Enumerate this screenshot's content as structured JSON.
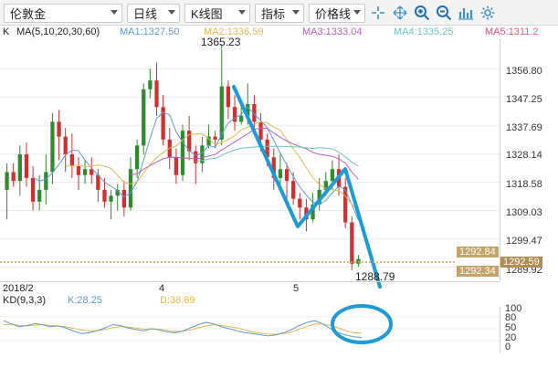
{
  "toolbar": {
    "symbol": "伦敦金",
    "period": "日线",
    "chart_type": "K线图",
    "indicator": "指标",
    "price_line": "价格线",
    "icons": [
      "crosshair-icon",
      "arrows-icon",
      "zoom-in-icon",
      "zoom-out-icon",
      "bar-chart-icon",
      "settings-icon"
    ]
  },
  "ma": {
    "k": "K",
    "params": "MA(5,10,20,30,60)",
    "ma1": "MA1:1327.50",
    "ma2": "MA2:1336.59",
    "ma3": "MA3:1333.04",
    "ma4": "MA4:1335.25",
    "ma5": "MA5:1311.2",
    "colors": {
      "ma1": "#5b9bd5",
      "ma2": "#e8b64a",
      "ma3": "#b85fc4",
      "ma4": "#6cc4c4",
      "ma5": "#e05a7a"
    }
  },
  "annotations": {
    "high": "1365.23",
    "low": "1288.79"
  },
  "price_axis": {
    "ticks": [
      "1356.80",
      "1347.25",
      "1337.69",
      "1328.14",
      "1318.58",
      "1309.03",
      "1299.47",
      "1289.92"
    ],
    "tag_upper": "1292.84",
    "tag_current": "1292.59",
    "tag_lower": "1292.34"
  },
  "date_axis": {
    "labels": [
      "2018/2",
      "4",
      "5"
    ]
  },
  "kd": {
    "params": "KD(9,3,3)",
    "k": "K:28.25",
    "d": "D:38.89",
    "ticks": [
      "100",
      "80",
      "50",
      "20",
      "0"
    ],
    "colors": {
      "k": "#5b9bd5",
      "d": "#e8b64a"
    }
  },
  "colors": {
    "up": "#2e8b2e",
    "down": "#d03030",
    "annotation": "#1e9bd7",
    "tag": "#c5a368"
  },
  "chart_data": {
    "type": "candlestick",
    "y_range": [
      1286,
      1366
    ],
    "candles": [
      [
        1316,
        1322,
        1306,
        1325
      ],
      [
        1322,
        1319,
        1317,
        1325
      ],
      [
        1319,
        1328,
        1314,
        1331
      ],
      [
        1328,
        1320,
        1317,
        1332
      ],
      [
        1320,
        1312,
        1309,
        1324
      ],
      [
        1312,
        1316,
        1309,
        1321
      ],
      [
        1316,
        1322,
        1311,
        1328
      ],
      [
        1322,
        1339,
        1318,
        1342
      ],
      [
        1339,
        1334,
        1326,
        1343
      ],
      [
        1334,
        1328,
        1322,
        1337
      ],
      [
        1328,
        1324,
        1320,
        1335
      ],
      [
        1324,
        1321,
        1316,
        1327
      ],
      [
        1321,
        1323,
        1318,
        1326
      ],
      [
        1323,
        1321,
        1318,
        1327
      ],
      [
        1321,
        1316,
        1312,
        1323
      ],
      [
        1316,
        1312,
        1310,
        1320
      ],
      [
        1312,
        1314,
        1306,
        1316
      ],
      [
        1314,
        1316,
        1309,
        1318
      ],
      [
        1316,
        1310,
        1307,
        1319
      ],
      [
        1310,
        1323,
        1309,
        1327
      ],
      [
        1323,
        1331,
        1320,
        1333
      ],
      [
        1331,
        1350,
        1328,
        1352
      ],
      [
        1350,
        1353,
        1347,
        1357
      ],
      [
        1353,
        1344,
        1341,
        1359
      ],
      [
        1344,
        1333,
        1331,
        1348
      ],
      [
        1333,
        1327,
        1323,
        1337
      ],
      [
        1327,
        1321,
        1318,
        1330
      ],
      [
        1321,
        1336,
        1319,
        1338
      ],
      [
        1336,
        1329,
        1326,
        1341
      ],
      [
        1329,
        1325,
        1318,
        1331
      ],
      [
        1325,
        1331,
        1322,
        1334
      ],
      [
        1331,
        1334,
        1330,
        1338
      ],
      [
        1334,
        1333,
        1330,
        1336
      ],
      [
        1333,
        1351,
        1331,
        1365.23
      ],
      [
        1351,
        1344,
        1340,
        1353
      ],
      [
        1344,
        1339,
        1336,
        1348
      ],
      [
        1339,
        1341,
        1338,
        1346
      ],
      [
        1341,
        1345,
        1338,
        1352
      ],
      [
        1345,
        1339,
        1335,
        1348
      ],
      [
        1339,
        1333,
        1329,
        1342
      ],
      [
        1333,
        1327,
        1324,
        1335
      ],
      [
        1327,
        1320,
        1316,
        1330
      ],
      [
        1320,
        1323,
        1316,
        1328
      ],
      [
        1323,
        1319,
        1313,
        1325
      ],
      [
        1319,
        1313,
        1311,
        1322
      ],
      [
        1313,
        1310,
        1306,
        1315
      ],
      [
        1310,
        1306,
        1302,
        1313
      ],
      [
        1306,
        1311,
        1305,
        1315
      ],
      [
        1311,
        1316,
        1309,
        1320
      ],
      [
        1316,
        1319,
        1314,
        1322
      ],
      [
        1319,
        1323,
        1316,
        1326
      ],
      [
        1323,
        1317,
        1314,
        1328
      ],
      [
        1317,
        1305,
        1303,
        1320
      ],
      [
        1305,
        1291,
        1288.79,
        1307
      ],
      [
        1291,
        1292.59,
        1290,
        1294
      ]
    ],
    "kd_k": [
      70,
      62,
      55,
      58,
      63,
      60,
      55,
      57,
      52,
      44,
      38,
      40,
      45,
      52,
      60,
      58,
      52,
      48,
      45,
      50,
      47,
      42,
      40,
      44,
      52,
      60,
      66,
      62,
      55,
      50,
      45,
      40,
      38,
      35,
      32,
      35,
      40,
      48,
      58,
      66,
      70,
      62,
      50,
      40,
      34,
      30,
      28.25
    ],
    "kd_d": [
      60,
      61,
      58,
      57,
      59,
      60,
      58,
      57,
      55,
      51,
      47,
      45,
      45,
      48,
      53,
      55,
      54,
      52,
      49,
      50,
      49,
      46,
      43,
      44,
      47,
      52,
      57,
      60,
      58,
      55,
      52,
      47,
      42,
      39,
      37,
      36,
      38,
      42,
      49,
      56,
      62,
      62,
      58,
      52,
      45,
      40,
      38.89
    ]
  }
}
